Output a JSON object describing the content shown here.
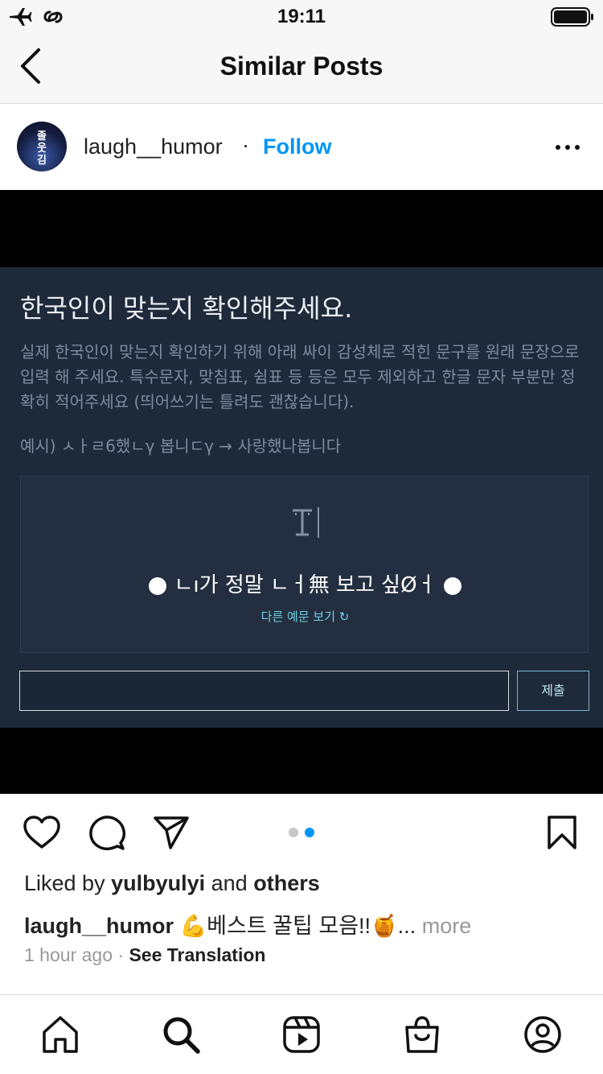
{
  "status_bar": {
    "time": "19:11"
  },
  "nav": {
    "title": "Similar Posts"
  },
  "post": {
    "username": "laugh__humor",
    "separator": "·",
    "follow_label": "Follow",
    "avatar_text": "졸\n웃\n김"
  },
  "media": {
    "title": "한국인이 맞는지 확인해주세요.",
    "description": "실제 한국인이 맞는지 확인하기 위해 아래 싸이 감성체로 적힌 문구를 원래 문장으로 입력 해 주세요. 특수문자, 맞침표, 쉼표 등 등은 모두 제외하고 한글 문자 부분만 정확히 적어주세요 (띄어쓰기는 틀려도 괜찮습니다).",
    "example": "예시) ㅅㅏㄹ6했ㄴγ 봅니ㄷγ → 사랑했나봅니다",
    "captcha_text": "ㄴı가 정말 ㄴㅓ無 보고 싶Øㅓ",
    "captcha_link": "다른 예문 보기 ↻",
    "submit_label": "제출",
    "page_indicator": {
      "total": 2,
      "active": 2
    }
  },
  "engagement": {
    "liked_prefix": "Liked by",
    "liked_user": "yulbyulyi",
    "liked_and": "and",
    "liked_others": "others",
    "caption_user": "laugh__humor",
    "caption_text": "💪베스트 꿀팁 모음!!🍯...",
    "caption_more": "more",
    "time_ago": "1 hour ago",
    "meta_sep": "·",
    "see_translation": "See Translation"
  },
  "icons": {
    "back": "chevron-left-icon",
    "airplane": "airplane-icon",
    "link": "link-icon",
    "battery": "battery-icon",
    "more": "more-dots-icon",
    "like": "heart-icon",
    "comment": "comment-icon",
    "share": "send-icon",
    "save": "bookmark-icon",
    "tabs": [
      "home-icon",
      "search-icon",
      "reels-icon",
      "shop-icon",
      "profile-icon"
    ]
  },
  "colors": {
    "follow": "#0095f6",
    "pager_active": "#0095f6",
    "pager_inactive": "#c7c7c7",
    "panel_bg": "#1e2a3a"
  }
}
